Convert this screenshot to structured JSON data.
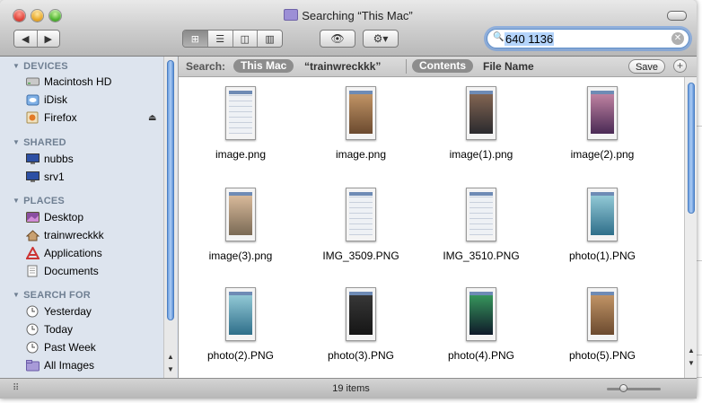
{
  "window": {
    "title": "Searching “This Mac”",
    "status": "19 items"
  },
  "toolbar": {
    "back": "◀",
    "forward": "▶",
    "view_icon": "⊞",
    "view_list": "☰",
    "view_column": "◫",
    "view_coverflow": "▥",
    "quicklook": "👁",
    "action": "⚙▾",
    "search_icon": "🔍",
    "search_value": "640 1136",
    "search_clear": "✕"
  },
  "sidebar": {
    "sections": [
      {
        "label": "DEVICES",
        "items": [
          {
            "label": "Macintosh HD",
            "icon": "drive-icon"
          },
          {
            "label": "iDisk",
            "icon": "idisk-icon"
          },
          {
            "label": "Firefox",
            "icon": "firefox-disk-icon"
          }
        ]
      },
      {
        "label": "SHARED",
        "items": [
          {
            "label": "nubbs",
            "icon": "monitor-icon"
          },
          {
            "label": "srv1",
            "icon": "monitor-icon"
          }
        ]
      },
      {
        "label": "PLACES",
        "items": [
          {
            "label": "Desktop",
            "icon": "desktop-icon"
          },
          {
            "label": "trainwreckkk",
            "icon": "home-icon"
          },
          {
            "label": "Applications",
            "icon": "applications-icon"
          },
          {
            "label": "Documents",
            "icon": "documents-icon"
          }
        ]
      },
      {
        "label": "SEARCH FOR",
        "items": [
          {
            "label": "Yesterday",
            "icon": "clock-icon"
          },
          {
            "label": "Today",
            "icon": "clock-icon"
          },
          {
            "label": "Past Week",
            "icon": "clock-icon"
          },
          {
            "label": "All Images",
            "icon": "images-folder-icon"
          }
        ]
      }
    ],
    "eject": "⏏"
  },
  "filter": {
    "search_label": "Search:",
    "scope_this_mac": "This Mac",
    "scope_user": "“trainwreckkk”",
    "contents": "Contents",
    "file_name": "File Name",
    "save": "Save",
    "plus": "+"
  },
  "files": [
    {
      "name": "image.png",
      "style": "settings"
    },
    {
      "name": "image.png",
      "style": "photo-warm"
    },
    {
      "name": "image(1).png",
      "style": "photo-dark"
    },
    {
      "name": "image(2).png",
      "style": "photo-purple"
    },
    {
      "name": "image(3).png",
      "style": "photo-face"
    },
    {
      "name": "IMG_3509.PNG",
      "style": "settings"
    },
    {
      "name": "IMG_3510.PNG",
      "style": "settings"
    },
    {
      "name": "photo(1).PNG",
      "style": "homescreen"
    },
    {
      "name": "photo(2).PNG",
      "style": "homescreen"
    },
    {
      "name": "photo(3).PNG",
      "style": "dark-app"
    },
    {
      "name": "photo(4).PNG",
      "style": "dark-blue"
    },
    {
      "name": "photo(5).PNG",
      "style": "photo-warm"
    }
  ],
  "colors": {
    "selection": "#b4d4fb",
    "scrollbar": "#6c9fe0",
    "sidebar_bg": "#dde4ee"
  }
}
